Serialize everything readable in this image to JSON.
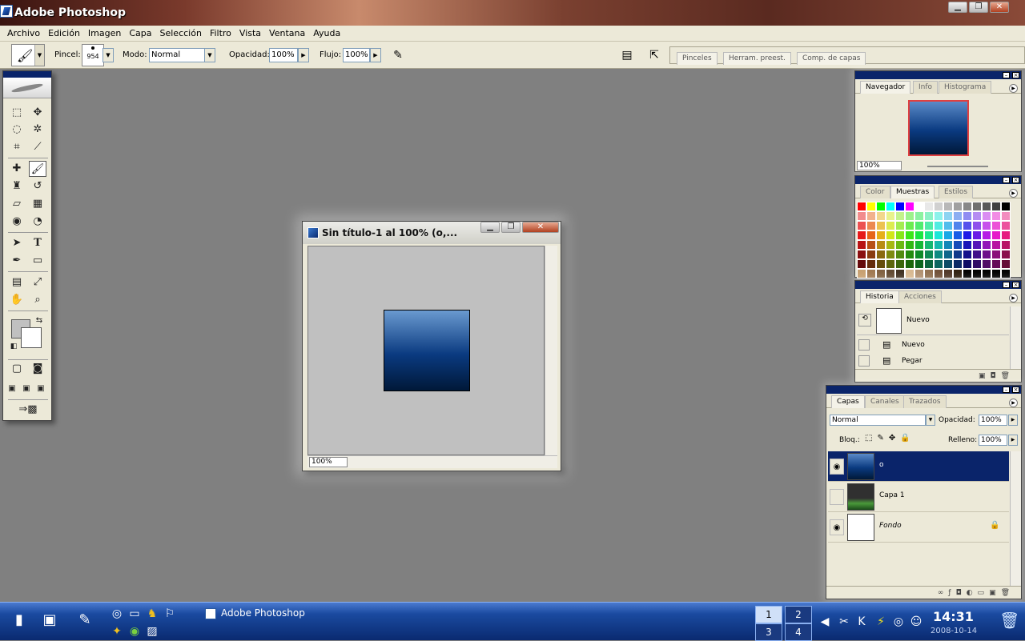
{
  "window": {
    "title": "Adobe Photoshop",
    "btn_min": "▁",
    "btn_max": "❐",
    "btn_close": "✕"
  },
  "menu": [
    "Archivo",
    "Edición",
    "Imagen",
    "Capa",
    "Selección",
    "Filtro",
    "Vista",
    "Ventana",
    "Ayuda"
  ],
  "options": {
    "brush_label": "Pincel:",
    "brush_size": "954",
    "mode_label": "Modo:",
    "mode_value": "Normal",
    "opacity_label": "Opacidad:",
    "opacity_value": "100%",
    "flow_label": "Flujo:",
    "flow_value": "100%"
  },
  "palette_well": [
    "Pinceles",
    "Herram. preest.",
    "Comp. de capas"
  ],
  "document": {
    "title": "Sin título-1 al 100% (o,...",
    "zoom": "100%"
  },
  "navigator": {
    "tabs": [
      "Navegador",
      "Info",
      "Histograma"
    ],
    "zoom": "100%"
  },
  "color_panel": {
    "tabs": [
      "Color",
      "Muestras",
      "Estilos"
    ]
  },
  "history": {
    "tabs": [
      "Historia",
      "Acciones"
    ],
    "snapshot": "Nuevo",
    "items": [
      "Nuevo",
      "Pegar"
    ]
  },
  "layers": {
    "tabs": [
      "Capas",
      "Canales",
      "Trazados"
    ],
    "blend": "Normal",
    "opacity_label": "Opacidad:",
    "opacity_value": "100%",
    "lock_label": "Bloq.:",
    "fill_label": "Relleno:",
    "fill_value": "100%",
    "items": [
      "o",
      "Capa 1",
      "Fondo"
    ]
  },
  "taskbar": {
    "task": "Adobe Photoshop",
    "pagers": [
      "1",
      "2",
      "3",
      "4"
    ],
    "time": "14:31",
    "date": "2008-10-14"
  },
  "colors": {
    "accent": "#0a246a",
    "taskbar": "#1a4aa0"
  }
}
